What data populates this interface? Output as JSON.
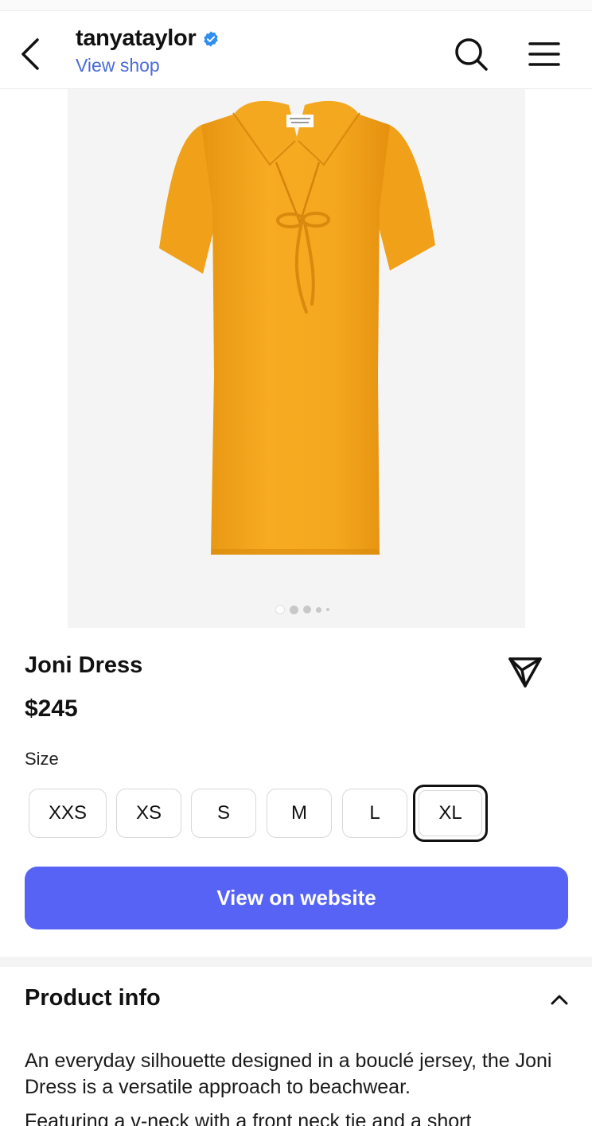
{
  "header": {
    "account_name": "tanyataylor",
    "view_shop_label": "View shop",
    "icons": [
      "back-chevron-icon",
      "verified-badge-icon",
      "search-icon",
      "menu-icon"
    ]
  },
  "carousel": {
    "image_alt": "Orange bouclé short-sleeve dress with collar and front neck tie",
    "slide_count": 5,
    "active_slide": 0
  },
  "product": {
    "title": "Joni Dress",
    "price": "$245",
    "size_label": "Size",
    "sizes": [
      "XXS",
      "XS",
      "S",
      "M",
      "L",
      "XL"
    ],
    "selected_size": "XL",
    "cta_label": "View on website"
  },
  "product_info": {
    "title": "Product info",
    "expanded": true,
    "description_1": "An everyday silhouette designed in a bouclé jersey, the Joni Dress is a versatile approach to beachwear.",
    "description_2": "Featuring a v-neck with a front neck tie and a short"
  },
  "colors": {
    "accent": "#5663f5",
    "link": "#4a6bd8",
    "verified": "#2f8ff0",
    "dress": "#f2a51e"
  }
}
